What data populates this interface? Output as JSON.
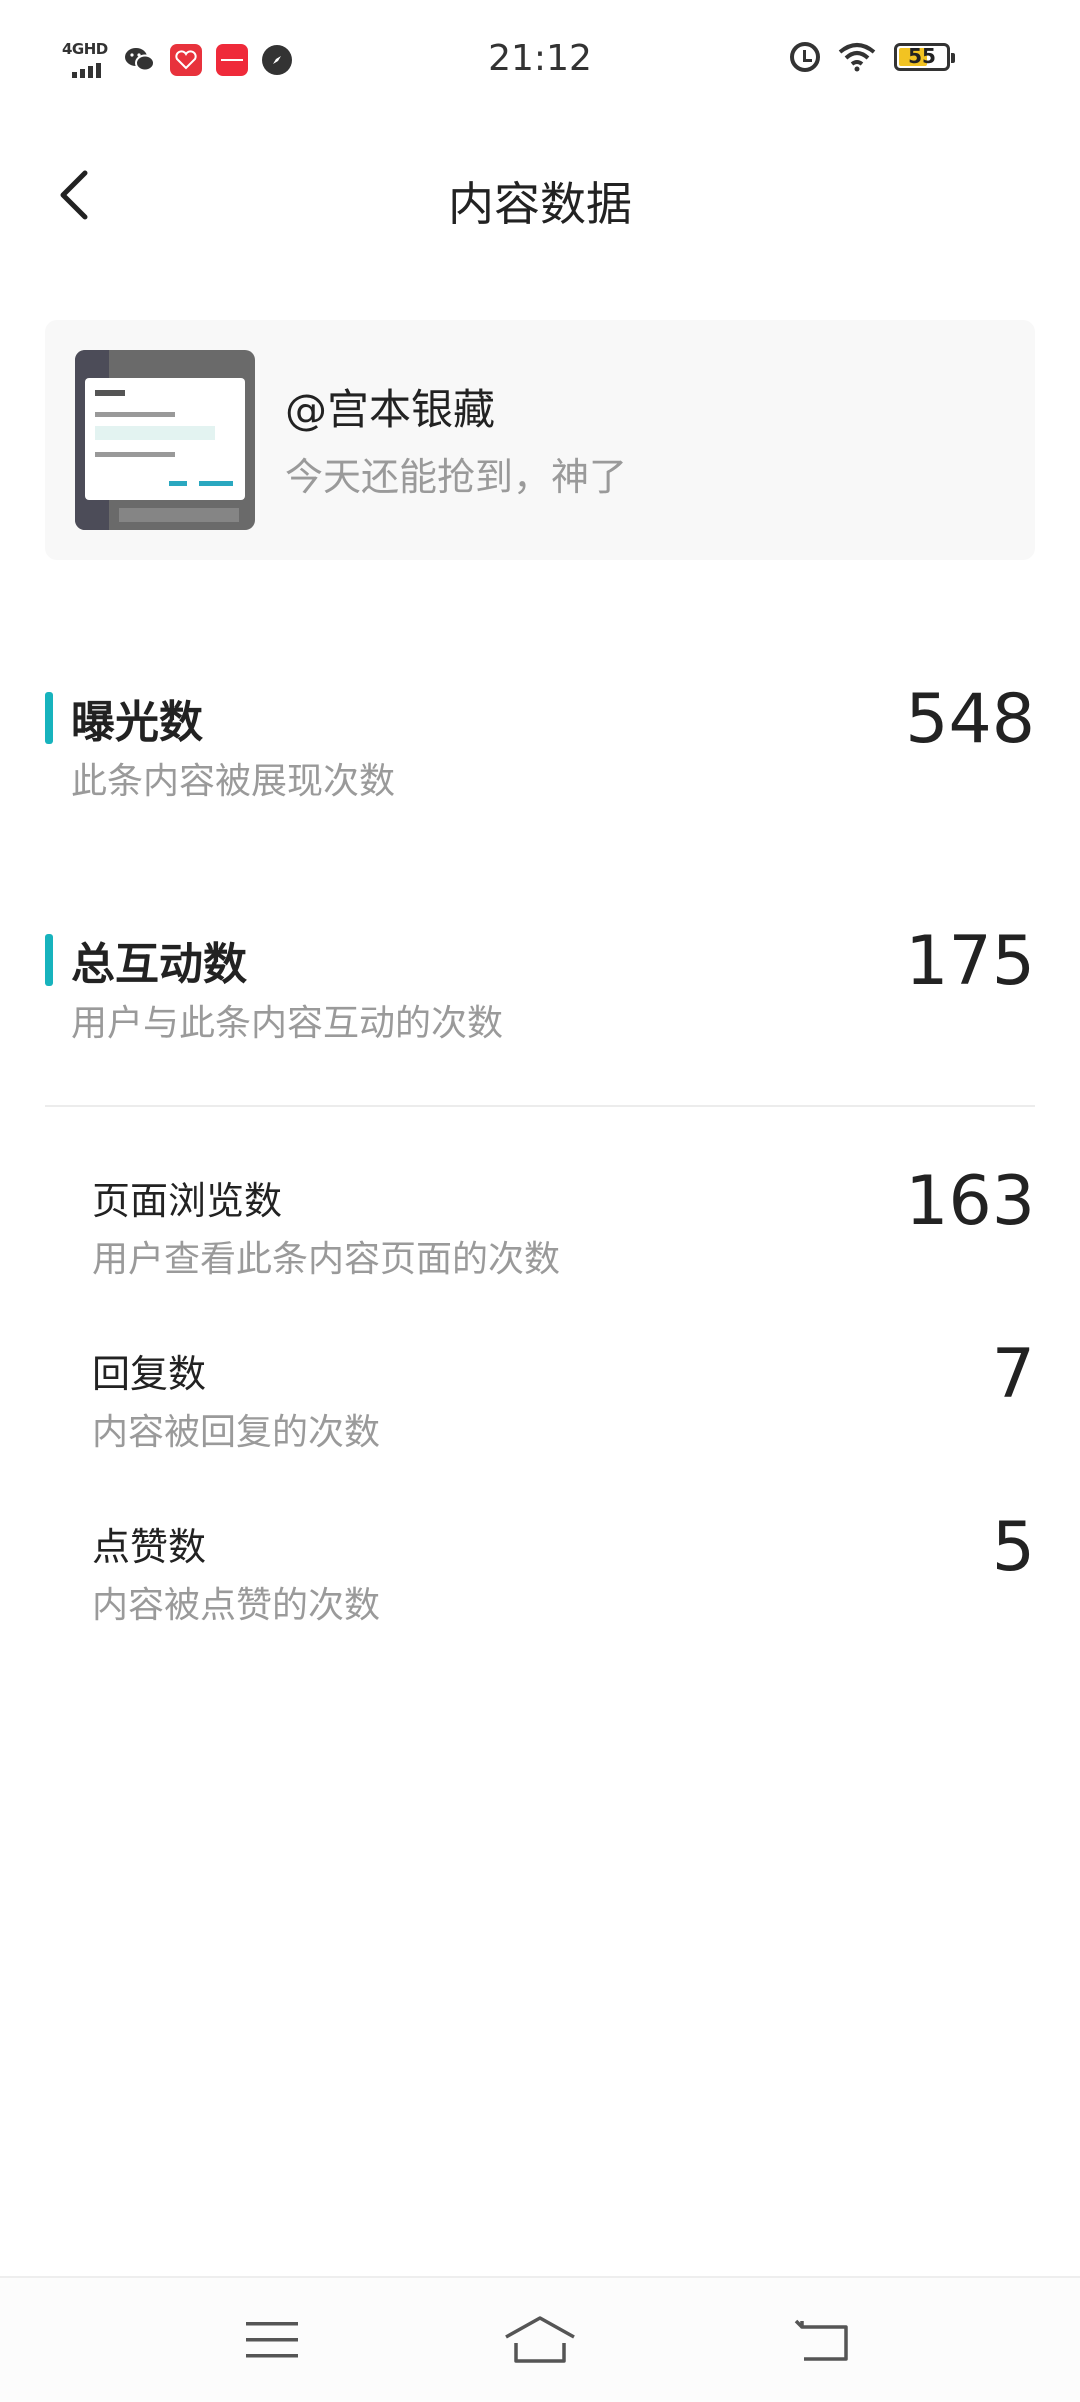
{
  "status_bar": {
    "time": "21:12",
    "network": "4GHD",
    "battery": "55",
    "icons": [
      "network-4g-icon",
      "wechat-icon",
      "red-app-icon",
      "red-app2-icon",
      "compass-icon",
      "alarm-icon",
      "wifi-icon",
      "battery-icon"
    ]
  },
  "header": {
    "title": "内容数据",
    "back_icon": "chevron-left-icon"
  },
  "post": {
    "user": "@宫本银藏",
    "text": "今天还能抢到，神了"
  },
  "metrics": [
    {
      "name": "曝光数",
      "desc": "此条内容被展现次数",
      "value": "548"
    },
    {
      "name": "总互动数",
      "desc": "用户与此条内容互动的次数",
      "value": "175"
    }
  ],
  "sub_metrics": [
    {
      "name": "页面浏览数",
      "desc": "用户查看此条内容页面的次数",
      "value": "163"
    },
    {
      "name": "回复数",
      "desc": "内容被回复的次数",
      "value": "7"
    },
    {
      "name": "点赞数",
      "desc": "内容被点赞的次数",
      "value": "5"
    }
  ],
  "colors": {
    "accent": "#17b3bd",
    "secondary_text": "#9a9a9a",
    "primary_text": "#222222"
  },
  "nav": {
    "icons": [
      "menu-icon",
      "home-icon",
      "back-icon"
    ]
  }
}
